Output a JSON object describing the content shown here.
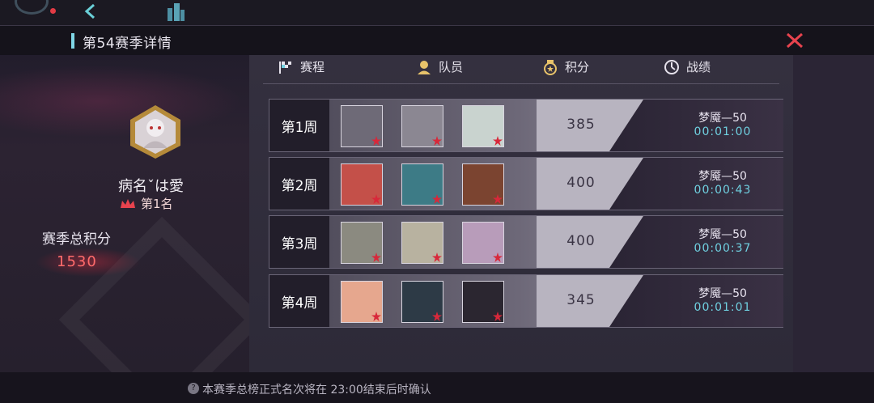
{
  "header": {
    "title": "第54赛季详情"
  },
  "tabs": [
    {
      "label": "赛程",
      "icon": "flag-icon"
    },
    {
      "label": "队员",
      "icon": "person-icon"
    },
    {
      "label": "积分",
      "icon": "medal-icon"
    },
    {
      "label": "战绩",
      "icon": "clock-icon"
    }
  ],
  "player": {
    "name": "病名ˇは愛",
    "rank": "第1名"
  },
  "season": {
    "total_label": "赛季总积分",
    "total_value": "1530"
  },
  "weeks": [
    {
      "label": "第1周",
      "score": "385",
      "stage": "梦魇—50",
      "time": "00:01:00",
      "members": [
        "#6e6a77",
        "#8b8792",
        "#c9d3cf"
      ]
    },
    {
      "label": "第2周",
      "score": "400",
      "stage": "梦魇—50",
      "time": "00:00:43",
      "members": [
        "#c45049",
        "#3d7b86",
        "#7b4430"
      ]
    },
    {
      "label": "第3周",
      "score": "400",
      "stage": "梦魇—50",
      "time": "00:00:37",
      "members": [
        "#8b8a80",
        "#b8b2a0",
        "#b89cba"
      ]
    },
    {
      "label": "第4周",
      "score": "345",
      "stage": "梦魇—50",
      "time": "00:01:01",
      "members": [
        "#e6a78e",
        "#2d3a46",
        "#2b2630"
      ]
    }
  ],
  "footer": {
    "note": "本赛季总榜正式名次将在 23:00结束后时确认"
  },
  "colors": {
    "accent_cyan": "#6fd0e0",
    "accent_red": "#ff6b6b",
    "close_red": "#e8434e"
  }
}
